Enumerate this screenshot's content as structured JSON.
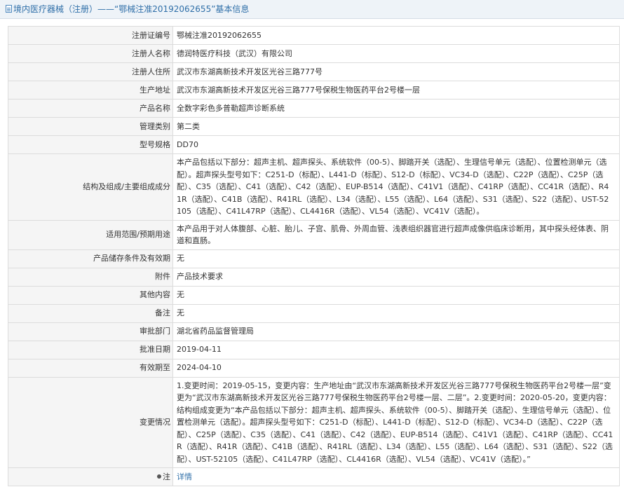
{
  "header": {
    "title": "境内医疗器械（注册）——“鄂械注准20192062655”基本信息"
  },
  "rows": [
    {
      "label": "注册证编号",
      "value": "鄂械注准20192062655"
    },
    {
      "label": "注册人名称",
      "value": "德润特医疗科技（武汉）有限公司"
    },
    {
      "label": "注册人住所",
      "value": "武汉市东湖高新技术开发区光谷三路777号"
    },
    {
      "label": "生产地址",
      "value": "武汉市东湖高新技术开发区光谷三路777号保税生物医药平台2号楼一层"
    },
    {
      "label": "产品名称",
      "value": "全数字彩色多普勒超声诊断系统"
    },
    {
      "label": "管理类别",
      "value": "第二类"
    },
    {
      "label": "型号规格",
      "value": "DD70"
    },
    {
      "label": "结构及组成/主要组成成分",
      "value": "本产品包括以下部分：超声主机、超声探头、系统软件（00-5）、脚踏开关（选配）、生理信号单元（选配）、位置检测单元（选配）。超声探头型号如下：C251-D（标配）、L441-D（标配）、S12-D（标配）、VC34-D（选配）、C22P（选配）、C25P（选配）、C35（选配）、C41（选配）、C42（选配）、EUP-B514（选配）、C41V1（选配）、C41RP（选配）、CC41R（选配）、R41R（选配）、C41B（选配）、R41RL（选配）、L34（选配）、L55（选配）、L64（选配）、S31（选配）、S22（选配）、UST-52105（选配）、C41L47RP（选配）、CL4416R（选配）、VL54（选配）、VC41V（选配）。"
    },
    {
      "label": "适用范围/预期用途",
      "value": "本产品用于对人体腹部、心脏、胎儿、子宫、肌骨、外周血管、浅表组织器官进行超声成像供临床诊断用，其中探头经体表、阴道和直肠。"
    },
    {
      "label": "产品储存条件及有效期",
      "value": "无"
    },
    {
      "label": "附件",
      "value": "产品技术要求"
    },
    {
      "label": "其他内容",
      "value": "无"
    },
    {
      "label": "备注",
      "value": "无"
    },
    {
      "label": "审批部门",
      "value": "湖北省药品监督管理局"
    },
    {
      "label": "批准日期",
      "value": "2019-04-11"
    },
    {
      "label": "有效期至",
      "value": "2024-04-10"
    },
    {
      "label": "变更情况",
      "value": "1.变更时间：2019-05-15，变更内容：生产地址由“武汉市东湖高新技术开发区光谷三路777号保税生物医药平台2号楼一层”变更为“武汉市东湖高新技术开发区光谷三路777号保税生物医药平台2号楼一层、二层”。2.变更时间：2020-05-20，变更内容：结构组成变更为“本产品包括以下部分：超声主机、超声探头、系统软件（00-5）、脚踏开关（选配）、生理信号单元（选配）、位置检测单元（选配）。超声探头型号如下：C251-D（标配）、L441-D（标配）、S12-D（标配）、VC34-D（选配）、C22P（选配）、C25P（选配）、C35（选配）、C41（选配）、C42（选配）、EUP-B514（选配）、C41V1（选配）、C41RP（选配）、CC41R（选配）、R41R（选配）、C41B（选配）、R41RL（选配）、L34（选配）、L55（选配）、L64（选配）、S31（选配）、S22（选配）、UST-52105（选配）、C41L47RP（选配）、CL4416R（选配）、VL54（选配）、VC41V（选配）。”"
    }
  ],
  "note": {
    "label": "注",
    "link_text": "详情",
    "icon": "pin-icon"
  }
}
